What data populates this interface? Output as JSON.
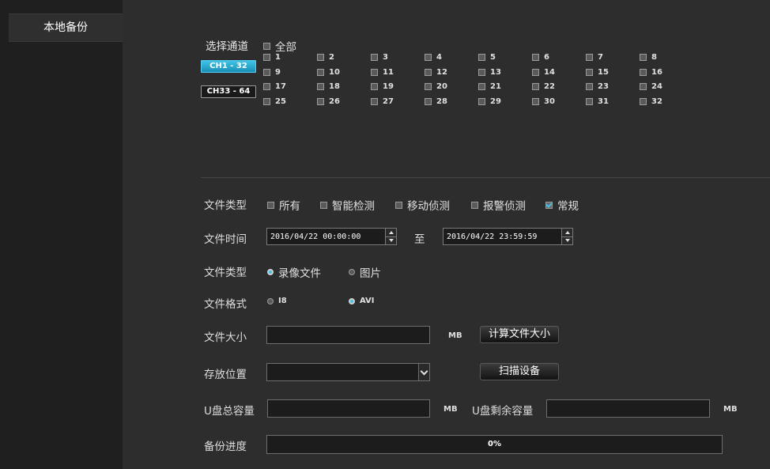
{
  "sidebar": {
    "items": [
      {
        "label": "本地备份"
      }
    ]
  },
  "channels": {
    "label": "选择通道",
    "all_label": "全部",
    "groups": [
      {
        "label": "CH1 - 32",
        "active": true
      },
      {
        "label": "CH33 - 64",
        "active": false
      }
    ],
    "items": [
      "1",
      "2",
      "3",
      "4",
      "5",
      "6",
      "7",
      "8",
      "9",
      "10",
      "11",
      "12",
      "13",
      "14",
      "15",
      "16",
      "17",
      "18",
      "19",
      "20",
      "21",
      "22",
      "23",
      "24",
      "25",
      "26",
      "27",
      "28",
      "29",
      "30",
      "31",
      "32"
    ]
  },
  "file_type": {
    "label": "文件类型",
    "options": [
      {
        "label": "所有",
        "checked": false
      },
      {
        "label": "智能检测",
        "checked": false
      },
      {
        "label": "移动侦测",
        "checked": false
      },
      {
        "label": "报警侦测",
        "checked": false
      },
      {
        "label": "常规",
        "checked": true
      }
    ]
  },
  "file_time": {
    "label": "文件时间",
    "start": "2016/04/22 00:00:00",
    "separator": "至",
    "end": "2016/04/22 23:59:59"
  },
  "media_type": {
    "label": "文件类型",
    "options": [
      {
        "label": "录像文件",
        "checked": true
      },
      {
        "label": "图片",
        "checked": false
      }
    ]
  },
  "file_format": {
    "label": "文件格式",
    "options": [
      {
        "label": "I8",
        "checked": false
      },
      {
        "label": "AVI",
        "checked": true
      }
    ]
  },
  "file_size": {
    "label": "文件大小",
    "value": "",
    "unit": "MB",
    "button": "计算文件大小"
  },
  "storage": {
    "label": "存放位置",
    "value": "",
    "button": "扫描设备"
  },
  "usb": {
    "total_label": "U盘总容量",
    "total_value": "",
    "total_unit": "MB",
    "free_label": "U盘剩余容量",
    "free_value": "",
    "free_unit": "MB"
  },
  "progress": {
    "label": "备份进度",
    "text": "0%",
    "percent": 0
  },
  "colors": {
    "accent": "#3fc3e6",
    "background": "#2d2d2d",
    "sidebar": "#1f1f1f"
  }
}
